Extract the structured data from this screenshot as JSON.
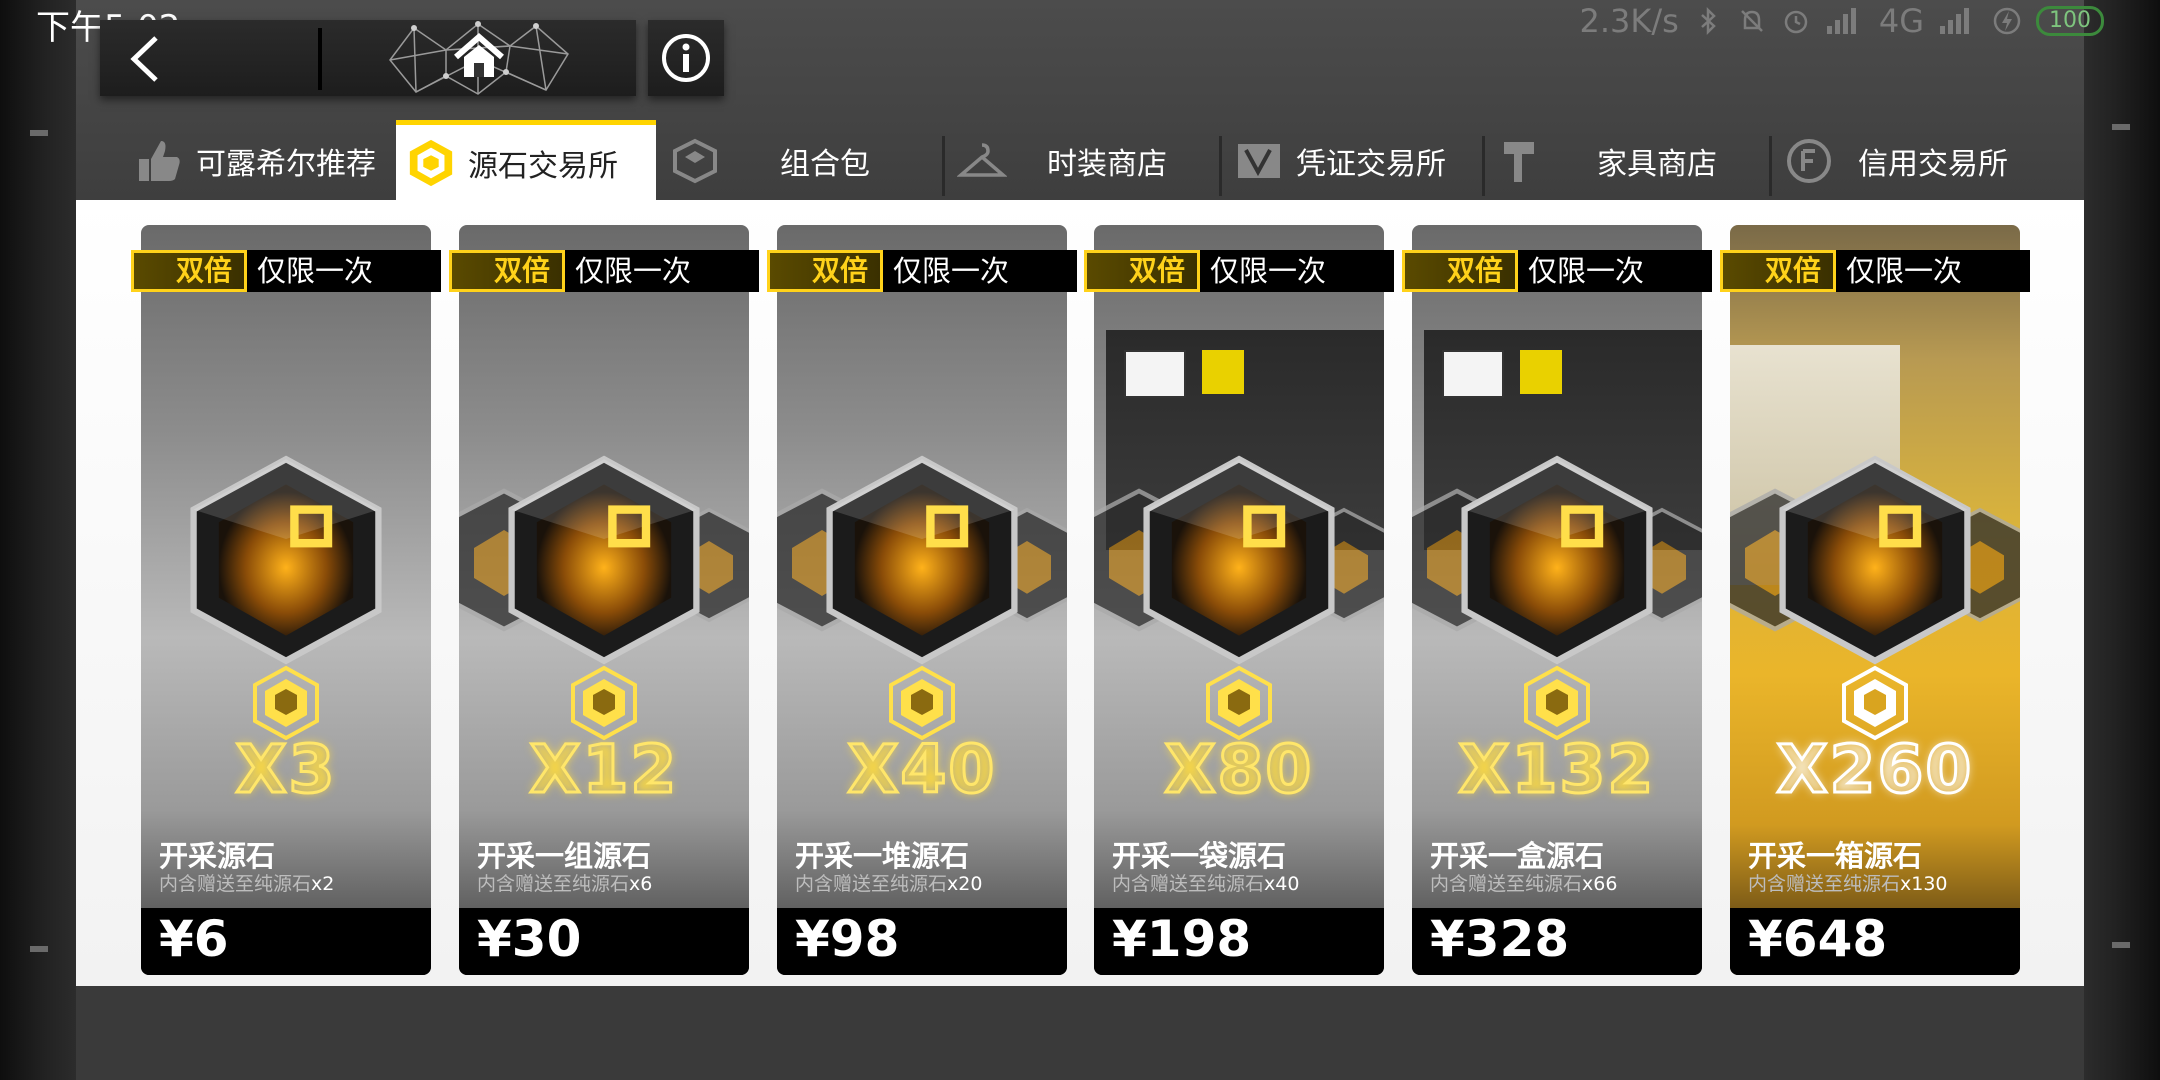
{
  "status_bar": {
    "time": "下午5:02",
    "net_speed": "2.3K/s",
    "network": "4G",
    "battery": "100"
  },
  "nav": {
    "back_icon": "chevron-left-icon",
    "home_icon": "home-icon",
    "info_icon": "info-icon"
  },
  "tabs": [
    {
      "label": "可露希尔推荐",
      "icon": "thumbs-up-icon"
    },
    {
      "label": "源石交易所",
      "icon": "originium-icon",
      "active": true
    },
    {
      "label": "组合包",
      "icon": "bundle-icon"
    },
    {
      "label": "时装商店",
      "icon": "hanger-icon"
    },
    {
      "label": "凭证交易所",
      "icon": "voucher-icon"
    },
    {
      "label": "家具商店",
      "icon": "hammer-icon"
    },
    {
      "label": "信用交易所",
      "icon": "credit-icon"
    }
  ],
  "ribbon": {
    "double": "双倍",
    "once": "仅限一次"
  },
  "products": [
    {
      "qty": "X3",
      "name": "开采源石",
      "bonus_text": "内含赠送至纯源石",
      "bonus_count": "x2",
      "price": "¥6"
    },
    {
      "qty": "X12",
      "name": "开采一组源石",
      "bonus_text": "内含赠送至纯源石",
      "bonus_count": "x6",
      "price": "¥30"
    },
    {
      "qty": "X40",
      "name": "开采一堆源石",
      "bonus_text": "内含赠送至纯源石",
      "bonus_count": "x20",
      "price": "¥98"
    },
    {
      "qty": "X80",
      "name": "开采一袋源石",
      "bonus_text": "内含赠送至纯源石",
      "bonus_count": "x40",
      "price": "¥198"
    },
    {
      "qty": "X132",
      "name": "开采一盒源石",
      "bonus_text": "内含赠送至纯源石",
      "bonus_count": "x66",
      "price": "¥328"
    },
    {
      "qty": "X260",
      "name": "开采一箱源石",
      "bonus_text": "内含赠送至纯源石",
      "bonus_count": "x130",
      "price": "¥648"
    }
  ],
  "colors": {
    "accent": "#ffd400",
    "panel": "#ffffff",
    "dark": "#1d1d1d"
  }
}
